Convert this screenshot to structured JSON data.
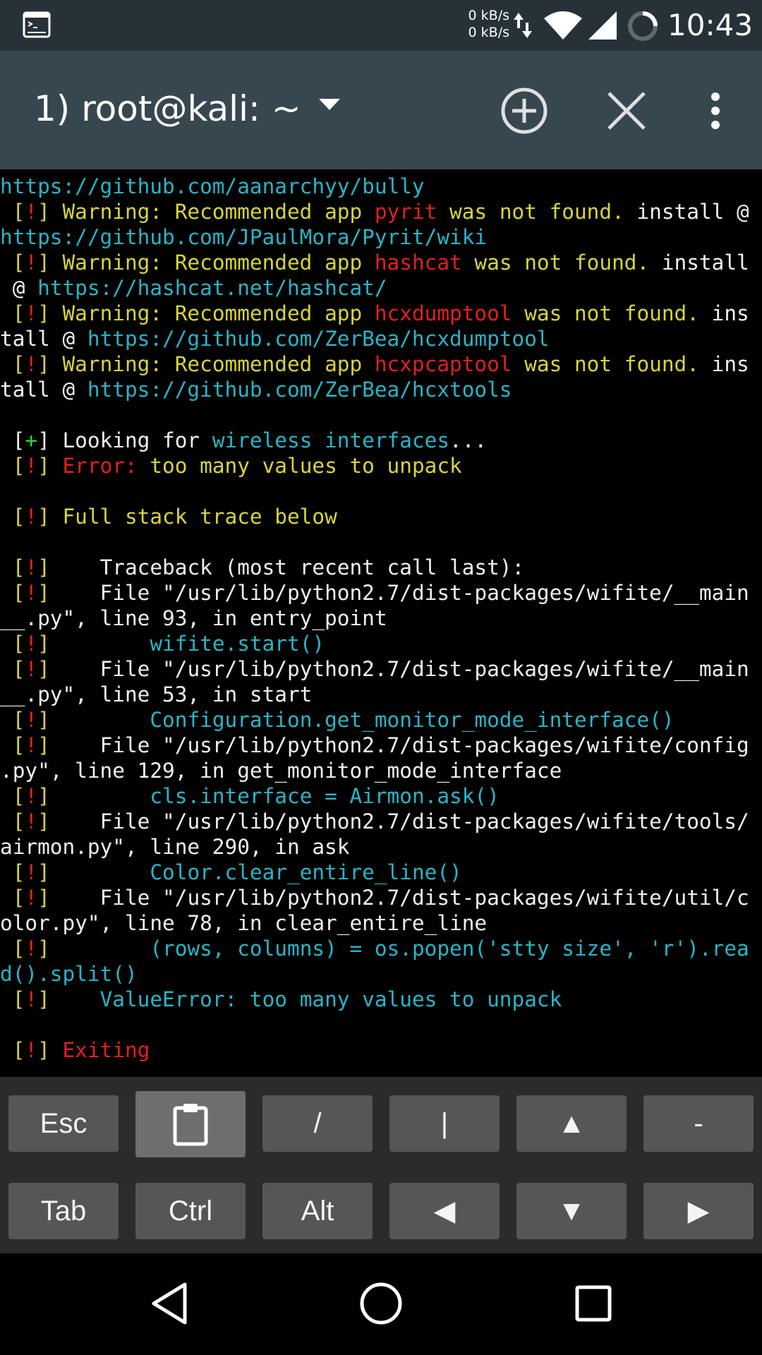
{
  "status_bar": {
    "notification_icon": "terminal-icon",
    "net_up": "0 kB/s",
    "net_down": "0 kB/s",
    "time": "10:43"
  },
  "app_bar": {
    "title": "1) root@kali: ~",
    "icons": [
      "dropdown-arrow-icon",
      "add-circle-icon",
      "close-icon",
      "more-vert-icon"
    ]
  },
  "colors": {
    "white": "#f0f0f0",
    "yellow": "#d8d43a",
    "red": "#e02020",
    "cyan": "#27b5c8",
    "green": "#28d828"
  },
  "terminal": {
    "lines": [
      [
        [
          "c",
          "https://github.com/aanarchyy/bully"
        ]
      ],
      [
        [
          "y",
          " ["
        ],
        [
          "r",
          "!"
        ],
        [
          "y",
          "] Warning: Recommended app "
        ],
        [
          "r",
          "pyrit"
        ],
        [
          "y",
          " was not found. "
        ],
        [
          "w",
          "install @"
        ]
      ],
      [
        [
          "c",
          "https://github.com/JPaulMora/Pyrit/wiki"
        ]
      ],
      [
        [
          "y",
          " ["
        ],
        [
          "r",
          "!"
        ],
        [
          "y",
          "] Warning: Recommended app "
        ],
        [
          "r",
          "hashcat"
        ],
        [
          "y",
          " was not found. "
        ],
        [
          "w",
          "install"
        ]
      ],
      [
        [
          "w",
          " @ "
        ],
        [
          "c",
          "https://hashcat.net/hashcat/"
        ]
      ],
      [
        [
          "y",
          " ["
        ],
        [
          "r",
          "!"
        ],
        [
          "y",
          "] Warning: Recommended app "
        ],
        [
          "r",
          "hcxdumptool"
        ],
        [
          "y",
          " was not found. "
        ],
        [
          "w",
          "ins"
        ]
      ],
      [
        [
          "w",
          "tall @ "
        ],
        [
          "c",
          "https://github.com/ZerBea/hcxdumptool"
        ]
      ],
      [
        [
          "y",
          " ["
        ],
        [
          "r",
          "!"
        ],
        [
          "y",
          "] Warning: Recommended app "
        ],
        [
          "r",
          "hcxpcaptool"
        ],
        [
          "y",
          " was not found. "
        ],
        [
          "w",
          "ins"
        ]
      ],
      [
        [
          "w",
          "tall @ "
        ],
        [
          "c",
          "https://github.com/ZerBea/hcxtools"
        ]
      ],
      [],
      [
        [
          "w",
          " ["
        ],
        [
          "g",
          "+"
        ],
        [
          "w",
          "] Looking for "
        ],
        [
          "c",
          "wireless interfaces"
        ],
        [
          "w",
          "..."
        ]
      ],
      [
        [
          "y",
          " ["
        ],
        [
          "r",
          "!"
        ],
        [
          "y",
          "] "
        ],
        [
          "r",
          "Error: "
        ],
        [
          "y",
          "too many values to unpack"
        ]
      ],
      [],
      [
        [
          "y",
          " ["
        ],
        [
          "r",
          "!"
        ],
        [
          "y",
          "] Full stack trace below"
        ]
      ],
      [],
      [
        [
          "y",
          " ["
        ],
        [
          "r",
          "!"
        ],
        [
          "y",
          "]    "
        ],
        [
          "w",
          "Traceback (most recent call last):"
        ]
      ],
      [
        [
          "y",
          " ["
        ],
        [
          "r",
          "!"
        ],
        [
          "y",
          "]    "
        ],
        [
          "w",
          "File \"/usr/lib/python2.7/dist-packages/wifite/__main"
        ]
      ],
      [
        [
          "w",
          "__.py\", line 93, in entry_point"
        ]
      ],
      [
        [
          "y",
          " ["
        ],
        [
          "r",
          "!"
        ],
        [
          "y",
          "]        "
        ],
        [
          "c",
          "wifite.start()"
        ]
      ],
      [
        [
          "y",
          " ["
        ],
        [
          "r",
          "!"
        ],
        [
          "y",
          "]    "
        ],
        [
          "w",
          "File \"/usr/lib/python2.7/dist-packages/wifite/__main"
        ]
      ],
      [
        [
          "w",
          "__.py\", line 53, in start"
        ]
      ],
      [
        [
          "y",
          " ["
        ],
        [
          "r",
          "!"
        ],
        [
          "y",
          "]        "
        ],
        [
          "c",
          "Configuration.get_monitor_mode_interface()"
        ]
      ],
      [
        [
          "y",
          " ["
        ],
        [
          "r",
          "!"
        ],
        [
          "y",
          "]    "
        ],
        [
          "w",
          "File \"/usr/lib/python2.7/dist-packages/wifite/config"
        ]
      ],
      [
        [
          "w",
          ".py\", line 129, in get_monitor_mode_interface"
        ]
      ],
      [
        [
          "y",
          " ["
        ],
        [
          "r",
          "!"
        ],
        [
          "y",
          "]        "
        ],
        [
          "c",
          "cls.interface = Airmon.ask()"
        ]
      ],
      [
        [
          "y",
          " ["
        ],
        [
          "r",
          "!"
        ],
        [
          "y",
          "]    "
        ],
        [
          "w",
          "File \"/usr/lib/python2.7/dist-packages/wifite/tools/"
        ]
      ],
      [
        [
          "w",
          "airmon.py\", line 290, in ask"
        ]
      ],
      [
        [
          "y",
          " ["
        ],
        [
          "r",
          "!"
        ],
        [
          "y",
          "]        "
        ],
        [
          "c",
          "Color.clear_entire_line()"
        ]
      ],
      [
        [
          "y",
          " ["
        ],
        [
          "r",
          "!"
        ],
        [
          "y",
          "]    "
        ],
        [
          "w",
          "File \"/usr/lib/python2.7/dist-packages/wifite/util/c"
        ]
      ],
      [
        [
          "w",
          "olor.py\", line 78, in clear_entire_line"
        ]
      ],
      [
        [
          "y",
          " ["
        ],
        [
          "r",
          "!"
        ],
        [
          "y",
          "]        "
        ],
        [
          "c",
          "(rows, columns) = os.popen('stty size', 'r').rea"
        ]
      ],
      [
        [
          "c",
          "d().split()"
        ]
      ],
      [
        [
          "y",
          " ["
        ],
        [
          "r",
          "!"
        ],
        [
          "y",
          "]    "
        ],
        [
          "c",
          "ValueError: too many values to unpack"
        ]
      ],
      [],
      [
        [
          "y",
          " ["
        ],
        [
          "r",
          "!"
        ],
        [
          "y",
          "] "
        ],
        [
          "r",
          "Exiting"
        ]
      ]
    ]
  },
  "extra_keys": {
    "row1": [
      {
        "label": "Esc",
        "name": "key-esc"
      },
      {
        "label": "",
        "name": "key-paste",
        "icon": "clipboard-icon"
      },
      {
        "label": "/",
        "name": "key-slash"
      },
      {
        "label": "|",
        "name": "key-pipe"
      },
      {
        "label": "▲",
        "name": "key-up"
      },
      {
        "label": "-",
        "name": "key-dash"
      }
    ],
    "row2": [
      {
        "label": "Tab",
        "name": "key-tab"
      },
      {
        "label": "Ctrl",
        "name": "key-ctrl"
      },
      {
        "label": "Alt",
        "name": "key-alt"
      },
      {
        "label": "◀",
        "name": "key-left"
      },
      {
        "label": "▼",
        "name": "key-down"
      },
      {
        "label": "▶",
        "name": "key-right"
      }
    ]
  },
  "nav_bar": {
    "icons": [
      "back-icon",
      "home-icon",
      "recents-icon"
    ]
  }
}
